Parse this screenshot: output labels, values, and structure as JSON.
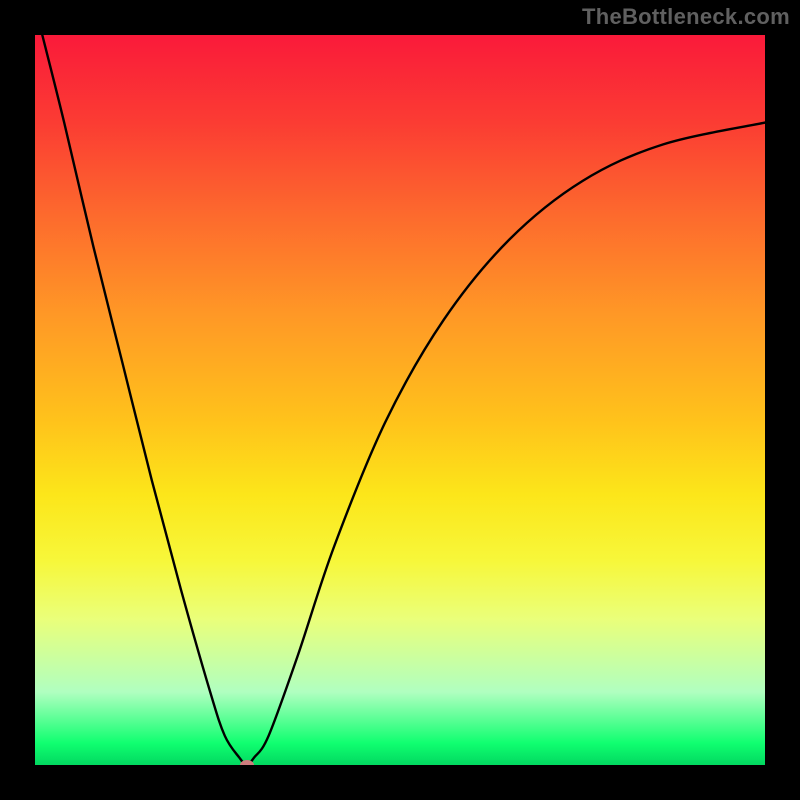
{
  "attribution": "TheBottleneck.com",
  "chart_data": {
    "type": "line",
    "title": "",
    "xlabel": "",
    "ylabel": "",
    "xlim": [
      0,
      100
    ],
    "ylim": [
      0,
      100
    ],
    "background_gradient": {
      "top": "#fa1a3a",
      "bottom": "#02d860",
      "description": "vertical red→yellow→green gradient (heat map of bottleneck severity, green = optimal)"
    },
    "series": [
      {
        "name": "bottleneck-curve",
        "x": [
          1,
          4,
          8,
          12,
          16,
          20,
          24,
          26,
          28,
          29,
          30,
          32,
          36,
          41,
          48,
          56,
          65,
          75,
          86,
          100
        ],
        "values": [
          100,
          88,
          71,
          55,
          39,
          24,
          10,
          4,
          1,
          0,
          1,
          4,
          15,
          30,
          47,
          61,
          72,
          80,
          85,
          88
        ]
      }
    ],
    "annotations": [
      {
        "name": "optimal-point",
        "x": 29,
        "y": 0,
        "shape": "ellipse",
        "color": "#cf7d7e"
      }
    ]
  },
  "colors": {
    "frame": "#000000",
    "curve": "#000000",
    "marker": "#cf7d7e",
    "attribution_text": "#606060"
  }
}
